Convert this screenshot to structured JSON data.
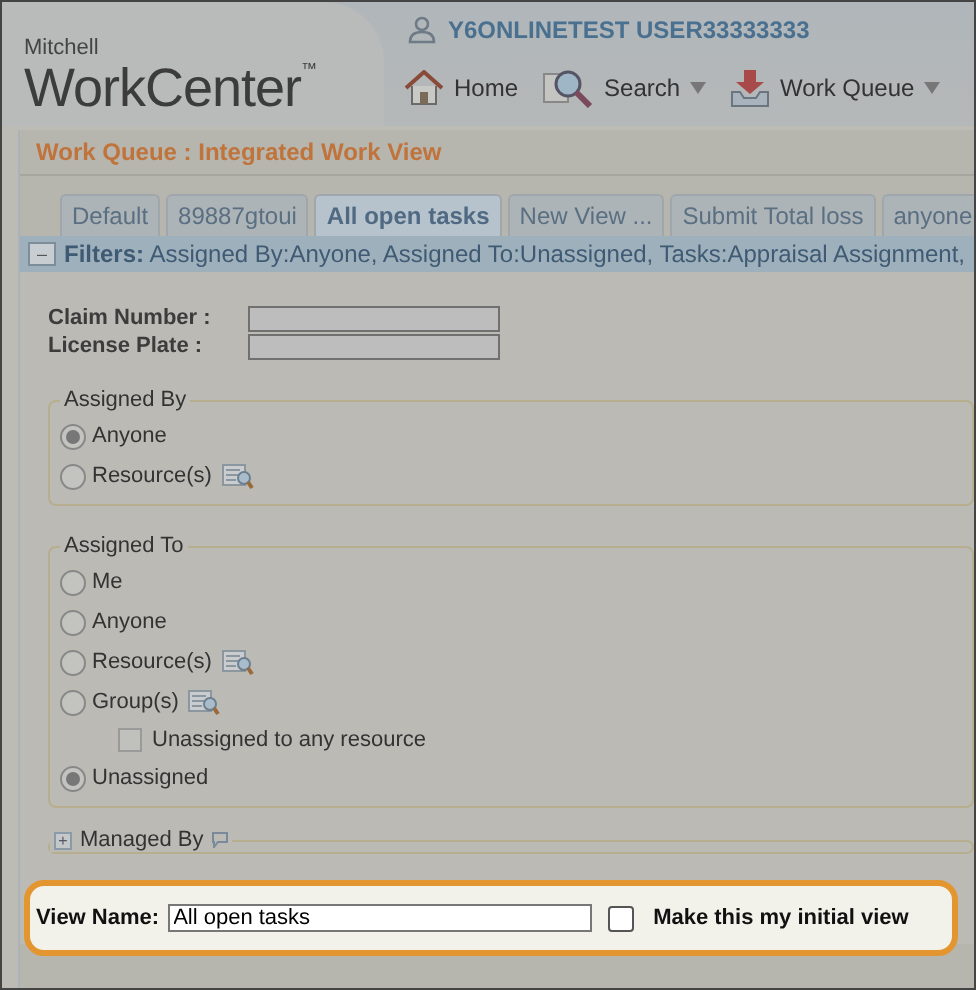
{
  "header": {
    "brand_small": "Mitchell",
    "brand": "WorkCenter",
    "trademark": "™",
    "user": "Y6ONLINETEST USER33333333",
    "nav": [
      {
        "label": "Home",
        "dropdown": false
      },
      {
        "label": "Search",
        "dropdown": true
      },
      {
        "label": "Work Queue",
        "dropdown": true
      }
    ]
  },
  "page_title": "Work Queue : Integrated Work View",
  "tabs": [
    {
      "label": "Default",
      "selected": false
    },
    {
      "label": "89887gtoui",
      "selected": false
    },
    {
      "label": "All open tasks",
      "selected": true
    },
    {
      "label": "New View ...",
      "selected": false
    },
    {
      "label": "Submit Total loss",
      "selected": false
    },
    {
      "label": "anyone",
      "selected": false
    }
  ],
  "filters": {
    "toggle": "–",
    "label": "Filters:",
    "summary": "Assigned By:Anyone, Assigned To:Unassigned, Tasks:Appraisal Assignment,"
  },
  "fields": [
    {
      "label": "Claim Number :"
    },
    {
      "label": "License Plate :"
    }
  ],
  "groups": [
    {
      "title": "Assigned By",
      "options": [
        {
          "kind": "radio",
          "label": "Anyone",
          "selected": true,
          "lookup": false
        },
        {
          "kind": "radio",
          "label": "Resource(s)",
          "selected": false,
          "lookup": true
        }
      ]
    },
    {
      "title": "Assigned To",
      "options": [
        {
          "kind": "radio",
          "label": "Me",
          "selected": false,
          "lookup": false
        },
        {
          "kind": "radio",
          "label": "Anyone",
          "selected": false,
          "lookup": false
        },
        {
          "kind": "radio",
          "label": "Resource(s)",
          "selected": false,
          "lookup": true
        },
        {
          "kind": "radio",
          "label": "Group(s)",
          "selected": false,
          "lookup": true
        },
        {
          "kind": "checkbox",
          "label": "Unassigned to any resource",
          "checked": false
        },
        {
          "kind": "radio",
          "label": "Unassigned",
          "selected": true,
          "lookup": false
        }
      ]
    }
  ],
  "managed_by": {
    "toggle": "+",
    "title": "Managed By"
  },
  "view_name": {
    "label": "View Name:",
    "value": "All open tasks",
    "initial_view": {
      "label": "Make this my initial view",
      "checked": false
    }
  }
}
